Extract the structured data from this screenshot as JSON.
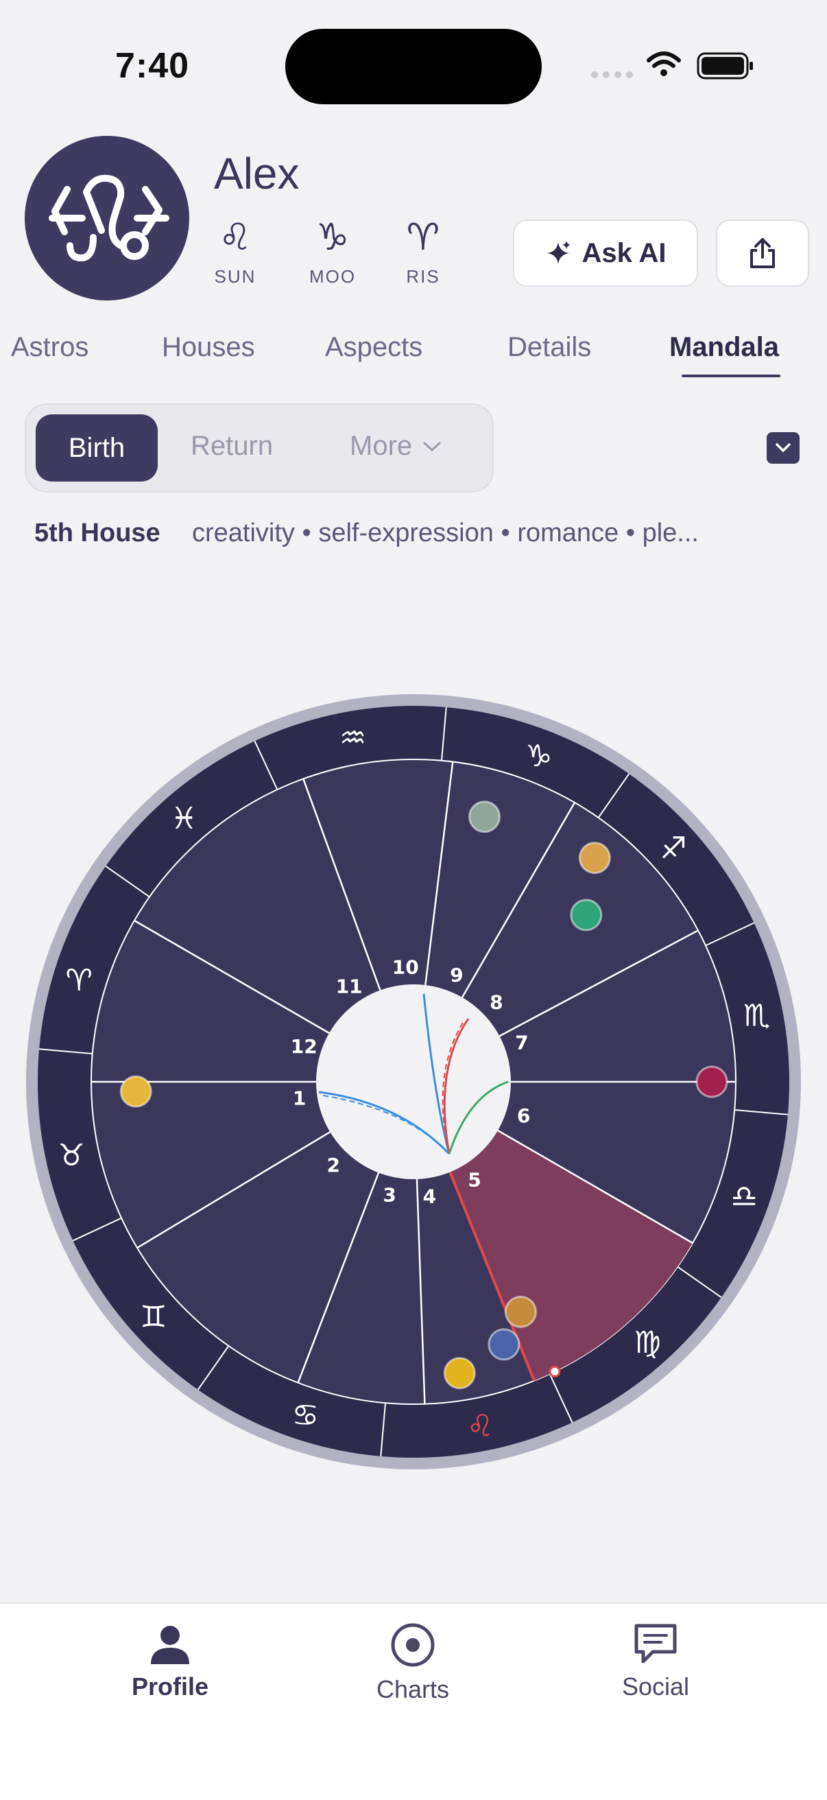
{
  "status_bar": {
    "time": "7:40"
  },
  "profile": {
    "name": "Alex",
    "avatar_icon": "leo-sign-icon",
    "big_three": [
      {
        "glyph": "♌︎",
        "label": "SUN"
      },
      {
        "glyph": "♑︎",
        "label": "MOO"
      },
      {
        "glyph": "♈︎",
        "label": "RIS"
      }
    ],
    "ask_ai_label": "Ask AI"
  },
  "tabs": [
    {
      "label": "Astros"
    },
    {
      "label": "Houses"
    },
    {
      "label": "Aspects"
    },
    {
      "label": "Details"
    },
    {
      "label": "Mandala",
      "active": true
    }
  ],
  "segments": {
    "birth": "Birth",
    "return": "Return",
    "more": "More"
  },
  "house_info": {
    "title": "5th House",
    "keywords": "creativity • self-expression • romance • ple..."
  },
  "wheel": {
    "zodiac": [
      "♈︎",
      "♉︎",
      "♊︎",
      "♋︎",
      "♌︎",
      "♍︎",
      "♎︎",
      "♏︎",
      "♐︎",
      "♑︎",
      "♒︎",
      "♓︎"
    ],
    "house_numbers": [
      "1",
      "2",
      "3",
      "4",
      "5",
      "6",
      "7",
      "8",
      "9",
      "10",
      "11",
      "12"
    ],
    "highlight_house": "5",
    "colors": {
      "ring": "#2d2a4c",
      "house": "#3b375b",
      "highlight": "#7e3d5c",
      "accent_red": "#e0484a"
    }
  },
  "nav": {
    "profile": "Profile",
    "charts": "Charts",
    "social": "Social"
  }
}
